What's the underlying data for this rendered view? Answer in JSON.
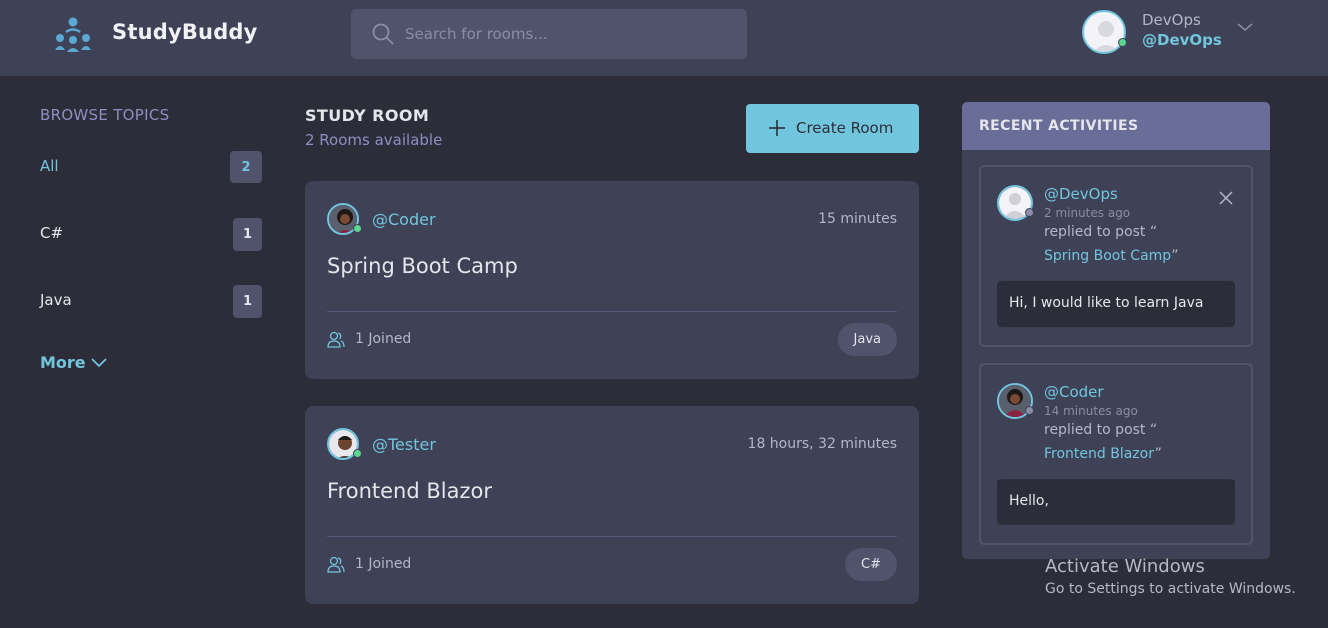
{
  "app": {
    "name": "StudyBuddy"
  },
  "search": {
    "placeholder": "Search for rooms..."
  },
  "user": {
    "name": "DevOps",
    "handle": "@DevOps"
  },
  "sidebar": {
    "title": "BROWSE TOPICS",
    "topics": [
      {
        "label": "All",
        "count": "2"
      },
      {
        "label": "C#",
        "count": "1"
      },
      {
        "label": "Java",
        "count": "1"
      }
    ],
    "more_label": "More"
  },
  "main": {
    "title": "STUDY ROOM",
    "subtitle": "2 Rooms available",
    "create_label": "Create Room",
    "rooms": [
      {
        "host": "@Coder",
        "time": "15 minutes",
        "name": "Spring Boot Camp",
        "joined": "1 Joined",
        "topic": "Java"
      },
      {
        "host": "@Tester",
        "time": "18 hours, 32 minutes",
        "name": "Frontend Blazor",
        "joined": "1 Joined",
        "topic": "C#"
      }
    ]
  },
  "activities": {
    "title": "RECENT ACTIVITIES",
    "items": [
      {
        "handle": "@DevOps",
        "time": "2 minutes ago",
        "action": "replied to post “",
        "room": "Spring Boot Camp",
        "close_quote": "”",
        "message": "Hi, I would like to learn Java"
      },
      {
        "handle": "@Coder",
        "time": "14 minutes ago",
        "action": "replied to post “",
        "room": "Frontend Blazor",
        "close_quote": "”",
        "message": "Hello,"
      }
    ]
  },
  "watermark": {
    "title": "Activate Windows",
    "subtitle": "Go to Settings to activate Windows."
  },
  "colors": {
    "accent": "#71c6dd",
    "background": "#2d2d39",
    "surface": "#3f4156",
    "activity_header": "#696d97",
    "online": "#5dd693"
  }
}
